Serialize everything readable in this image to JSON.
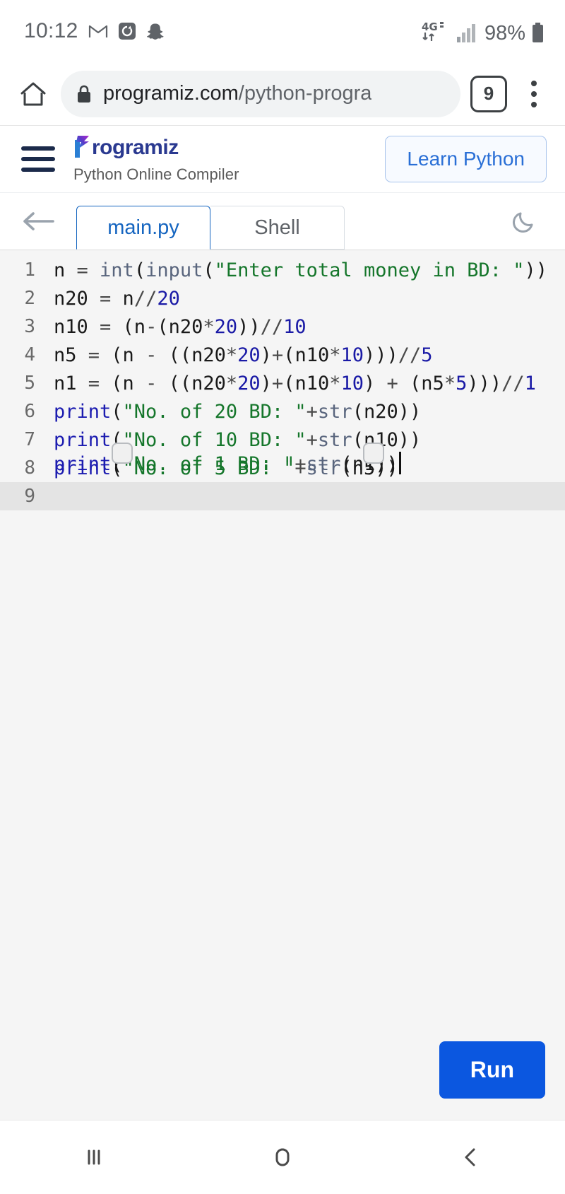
{
  "status_bar": {
    "time": "10:12",
    "battery_percent": "98%",
    "network": "4G",
    "icons": [
      "gmail-icon",
      "app-icon",
      "snapchat-icon",
      "4g-data-icon",
      "signal-bars-icon",
      "battery-icon"
    ]
  },
  "browser": {
    "home_icon": "home-icon",
    "lock_icon": "lock-icon",
    "url_host": "programiz.com",
    "url_path": "/python-progra",
    "tab_count": "9",
    "menu_icon": "overflow-menu-icon"
  },
  "site_header": {
    "menu_icon": "hamburger-menu-icon",
    "brand_initial": "P",
    "brand_name": "rogramiz",
    "subtitle": "Python Online Compiler",
    "cta_label": "Learn Python"
  },
  "toolbar": {
    "back_icon": "back-arrow-icon",
    "tabs": [
      {
        "label": "main.py",
        "active": true
      },
      {
        "label": "Shell",
        "active": false
      }
    ],
    "theme_icon": "moon-icon"
  },
  "editor": {
    "active_line": 9,
    "run_label": "Run",
    "lines": [
      {
        "n": "1",
        "text": "n = int(input(\"Enter total money in BD: \"))"
      },
      {
        "n": "2",
        "text": "n20 = n//20"
      },
      {
        "n": "3",
        "text": "n10 = (n-(n20*20))//10"
      },
      {
        "n": "4",
        "text": "n5 = (n - ((n20*20)+(n10*10)))//5"
      },
      {
        "n": "5",
        "text": "n1 = (n - ((n20*20)+(n10*10) + (n5*5)))//1"
      },
      {
        "n": "6",
        "text": "print(\"No. of 20 BD: \"+str(n20))"
      },
      {
        "n": "7",
        "text": "print(\"No. of 10 BD: \"+str(n10))"
      },
      {
        "n": "8",
        "text": "print(\"No. of 5 BD: \"+str(n5))"
      },
      {
        "n": "9",
        "text": "print(\"No. of 1 BD: \"+str(n1))"
      }
    ]
  },
  "android_nav": {
    "recents_icon": "recents-icon",
    "home_icon": "home-circle-icon",
    "back_icon": "back-chevron-icon"
  },
  "colors": {
    "accent_blue": "#0b57e0",
    "tab_active": "#1565c0",
    "brand_navy": "#2a3990",
    "string_green": "#15762b",
    "number_blue": "#1a1aa6"
  }
}
